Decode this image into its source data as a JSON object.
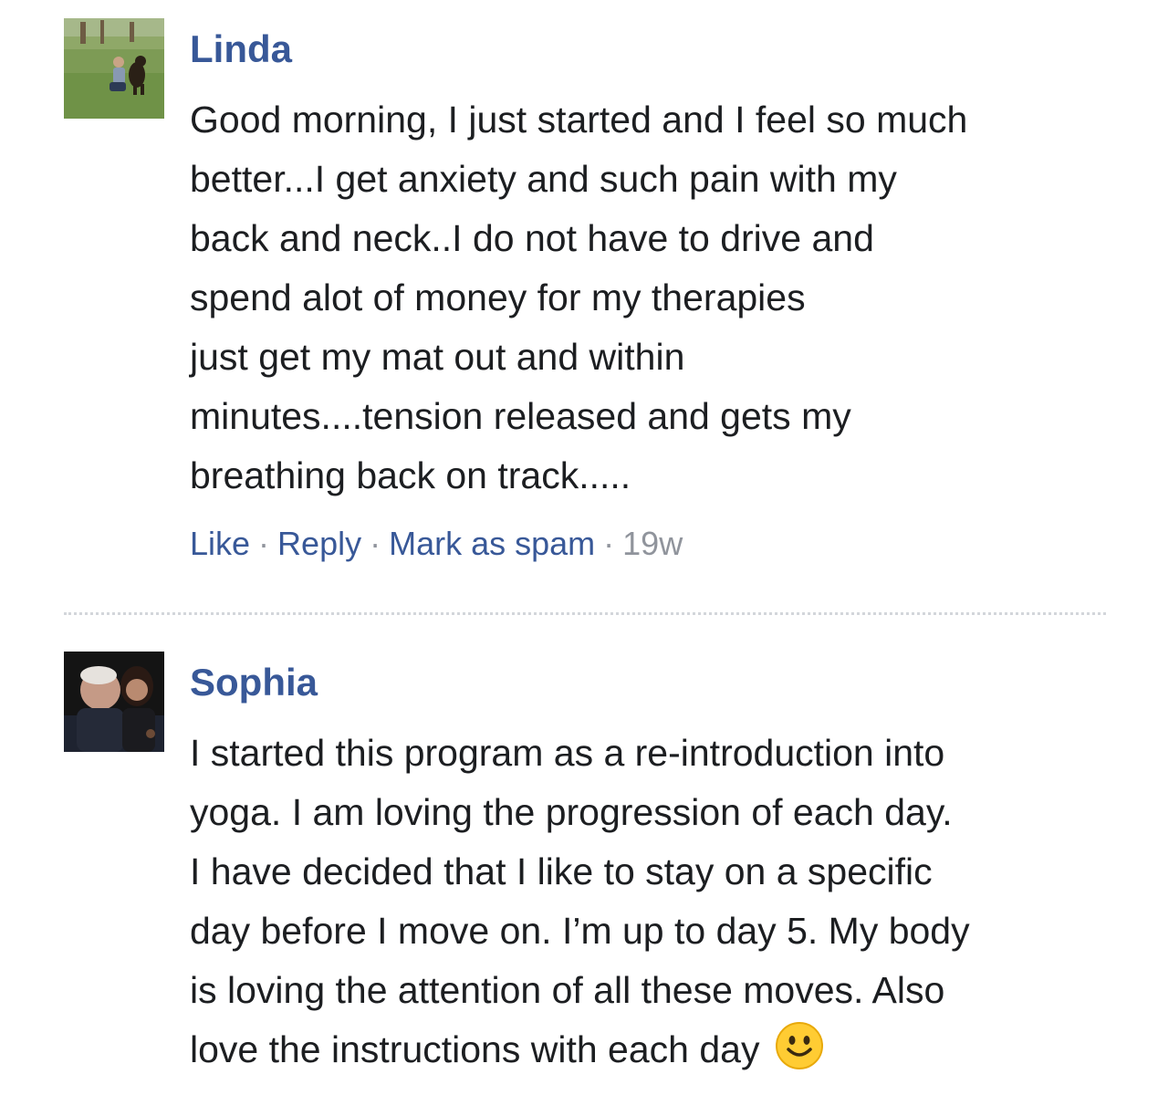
{
  "comments": [
    {
      "author": "Linda",
      "lines": [
        "Good morning, I just started and I feel so much",
        "better...I get anxiety and such pain with my",
        "back and neck..I do not have to drive and",
        "spend alot of money for my therapies",
        "just get my mat out and within",
        "minutes....tension released and gets my",
        "breathing back on track....."
      ],
      "actions": {
        "like": "Like",
        "reply": "Reply",
        "spam": "Mark as spam",
        "separator": "·",
        "time": "19w"
      }
    },
    {
      "author": "Sophia",
      "lines": [
        "I started this program as a re-introduction into",
        "yoga. I am loving the progression of each day.",
        "I have decided that I like to stay on a specific",
        "day before I move on. I’m up to day 5. My body",
        "is loving the attention of all these moves. Also",
        "love the instructions with each day"
      ],
      "emoji": "smiley-emoji"
    }
  ],
  "colors": {
    "author": "#385898",
    "link": "#385898",
    "meta": "#90949c",
    "text": "#1c1e21",
    "divider": "#d3d6db"
  }
}
